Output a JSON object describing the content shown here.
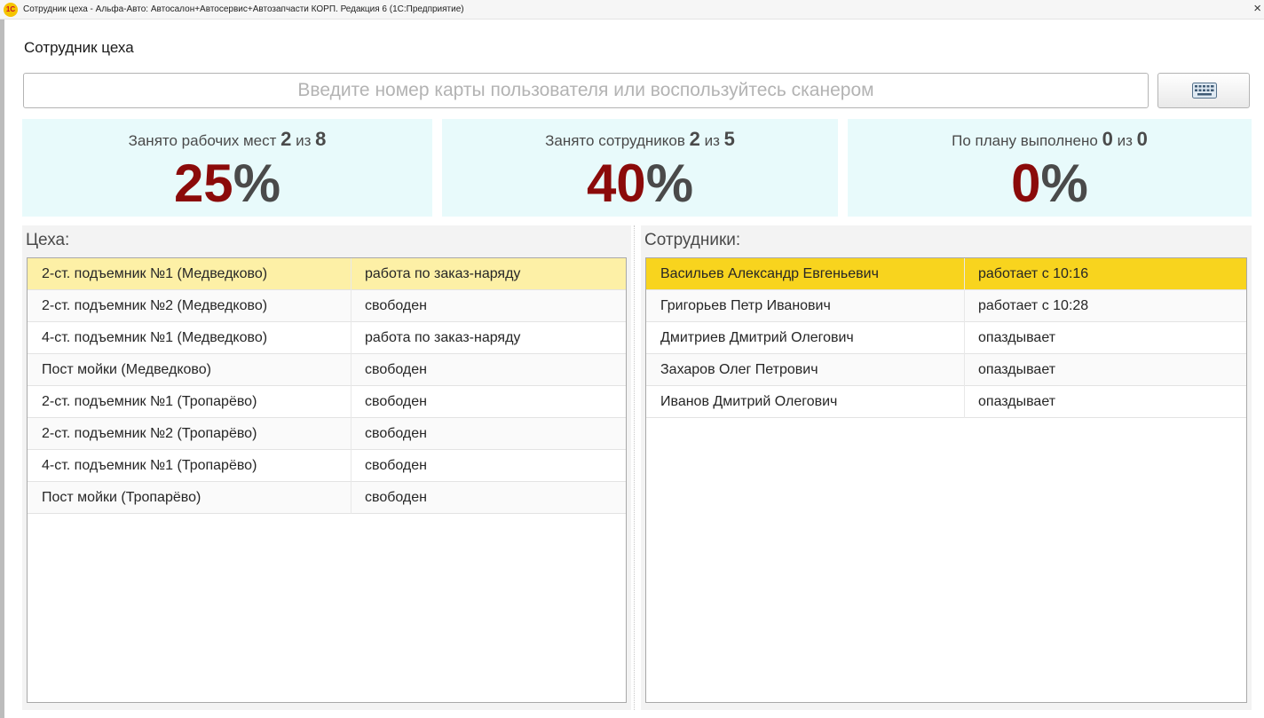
{
  "window": {
    "title": "Сотрудник цеха - Альфа-Авто: Автосалон+Автосервис+Автозапчасти КОРП. Редакция 6  (1С:Предприятие)",
    "logo_text": "1С",
    "close_symbol": "×"
  },
  "form": {
    "title": "Сотрудник цеха",
    "card_placeholder": "Введите номер карты пользователя или воспользуйтесь сканером",
    "card_value": ""
  },
  "stats": [
    {
      "label": "Занято рабочих мест",
      "value": "2",
      "sep": "из",
      "total": "8",
      "percent": "25",
      "percent_sign": "%"
    },
    {
      "label": "Занято сотрудников",
      "value": "2",
      "sep": "из",
      "total": "5",
      "percent": "40",
      "percent_sign": "%"
    },
    {
      "label": "По плану выполнено",
      "value": "0",
      "sep": "из",
      "total": "0",
      "percent": "0",
      "percent_sign": "%"
    }
  ],
  "workshops": {
    "title": "Цеха:",
    "rows": [
      {
        "name": "2-ст. подъемник №1 (Медведково)",
        "status": "работа по заказ-наряду"
      },
      {
        "name": "2-ст. подъемник №2 (Медведково)",
        "status": "свободен"
      },
      {
        "name": "4-ст. подъемник №1 (Медведково)",
        "status": "работа по заказ-наряду"
      },
      {
        "name": "Пост мойки (Медведково)",
        "status": "свободен"
      },
      {
        "name": "2-ст. подъемник №1 (Тропарёво)",
        "status": "свободен"
      },
      {
        "name": "2-ст. подъемник №2 (Тропарёво)",
        "status": "свободен"
      },
      {
        "name": "4-ст. подъемник №1 (Тропарёво)",
        "status": "свободен"
      },
      {
        "name": "Пост мойки (Тропарёво)",
        "status": "свободен"
      }
    ]
  },
  "employees": {
    "title": "Сотрудники:",
    "rows": [
      {
        "name": "Васильев Александр Евгеньевич",
        "status": "работает с 10:16"
      },
      {
        "name": "Григорьев Петр Иванович",
        "status": "работает с 10:28"
      },
      {
        "name": "Дмитриев Дмитрий Олегович",
        "status": "опаздывает"
      },
      {
        "name": "Захаров Олег Петрович",
        "status": "опаздывает"
      },
      {
        "name": "Иванов Дмитрий Олегович",
        "status": "опаздывает"
      }
    ]
  },
  "colors": {
    "percent_accent": "#8b0a0a",
    "stat_background": "#e8fafb",
    "selected_row": "#fdf0a6",
    "selected_row_strong": "#f8d41e"
  },
  "icons": {
    "keyboard_button": "keyboard-icon"
  }
}
